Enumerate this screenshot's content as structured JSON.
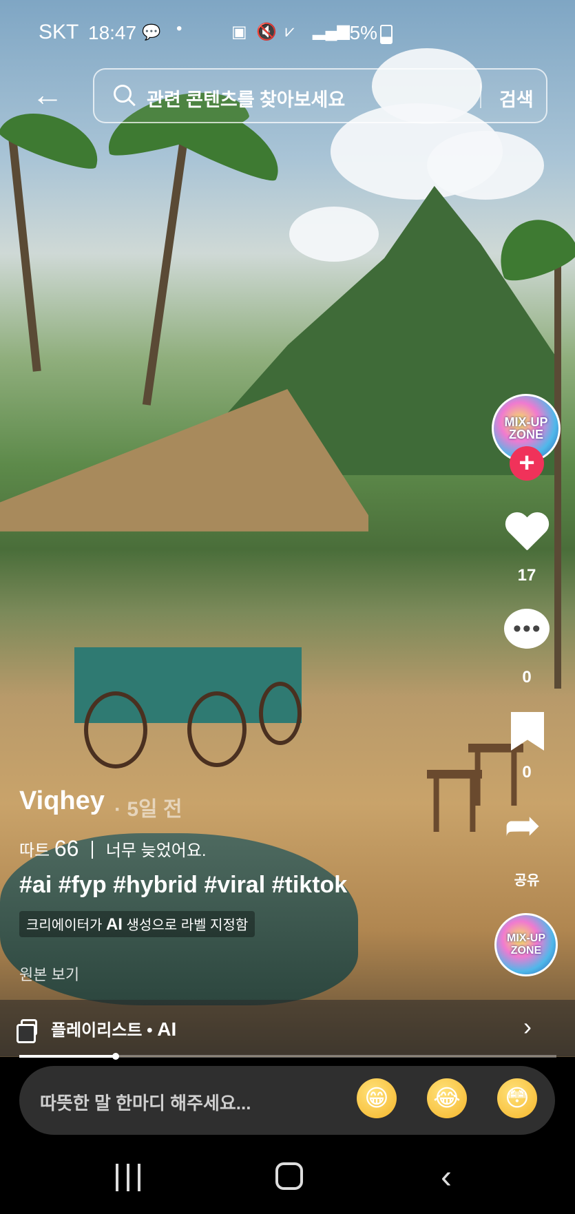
{
  "status_bar": {
    "carrier": "SKT",
    "time": "18:47",
    "battery": "35%"
  },
  "search": {
    "placeholder": "관련 콘텐츠를 찾아보세요",
    "button": "검색"
  },
  "creator": {
    "name": "Viqhey",
    "posted_ago": "· 5일 전",
    "avatar_text": "MIX-UP ZONE"
  },
  "rail": {
    "likes": "17",
    "comments": "0",
    "saves": "0",
    "share_label": "공유"
  },
  "caption": {
    "prefix": "따트",
    "number": "66",
    "text": "너무 늦었어요.",
    "hashtags": "#ai #fyp #hybrid #viral #tiktok",
    "ai_label_pre": "크리에이터가",
    "ai_label_ai": "AI",
    "ai_label_post": "생성으로 라벨 지정함",
    "view_original": "원본 보기"
  },
  "playlist": {
    "label": "플레이리스트",
    "name": "AI"
  },
  "progress": {
    "fraction": 0.18
  },
  "comment": {
    "placeholder": "따뜻한 말 한마디 해주세요...",
    "emojis": [
      "😁",
      "😂",
      "😳"
    ]
  }
}
